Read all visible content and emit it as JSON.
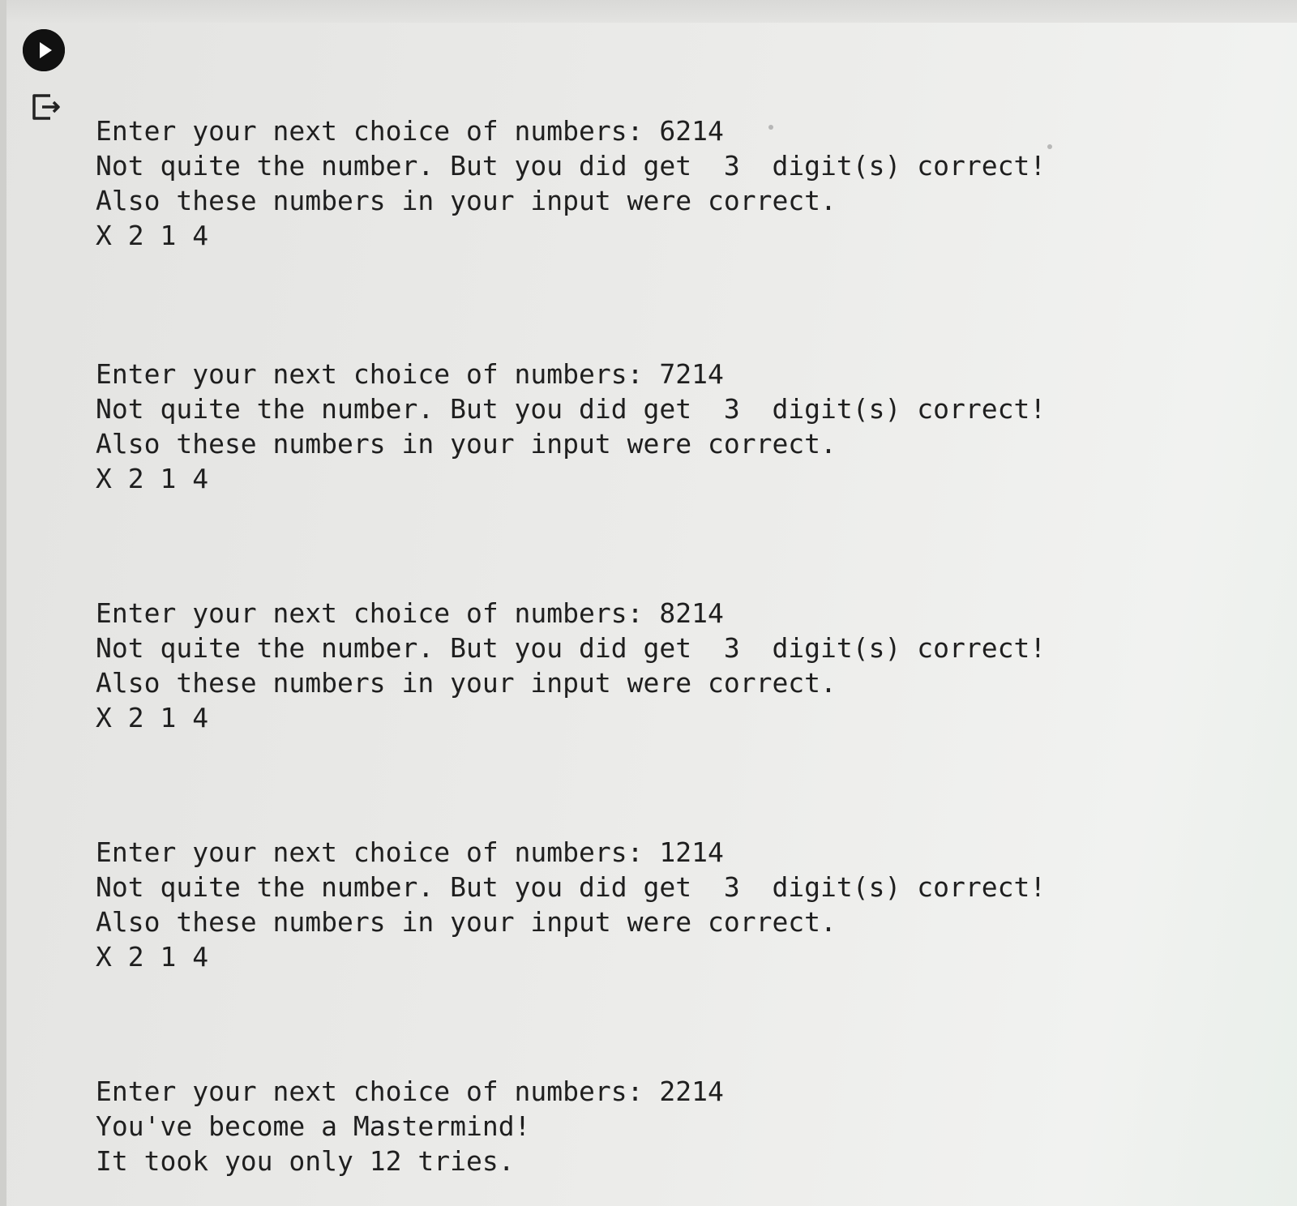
{
  "icons": {
    "run": "play-circle-icon",
    "output": "output-exit-icon"
  },
  "output": {
    "guesses": [
      {
        "prompt": "Enter your next choice of numbers: 6214",
        "result": "Not quite the number. But you did get  3  digit(s) correct!",
        "note": "Also these numbers in your input were correct.",
        "pattern": "X 2 1 4"
      },
      {
        "prompt": "Enter your next choice of numbers: 7214",
        "result": "Not quite the number. But you did get  3  digit(s) correct!",
        "note": "Also these numbers in your input were correct.",
        "pattern": "X 2 1 4"
      },
      {
        "prompt": "Enter your next choice of numbers: 8214",
        "result": "Not quite the number. But you did get  3  digit(s) correct!",
        "note": "Also these numbers in your input were correct.",
        "pattern": "X 2 1 4"
      },
      {
        "prompt": "Enter your next choice of numbers: 1214",
        "result": "Not quite the number. But you did get  3  digit(s) correct!",
        "note": "Also these numbers in your input were correct.",
        "pattern": "X 2 1 4"
      }
    ],
    "final": {
      "prompt": "Enter your next choice of numbers: 2214",
      "message": "You've become a Mastermind!",
      "tries": "It took you only 12 tries."
    }
  },
  "colors": {
    "text": "#1f1f1f",
    "run_button": "#111111",
    "background": "#ececea"
  }
}
